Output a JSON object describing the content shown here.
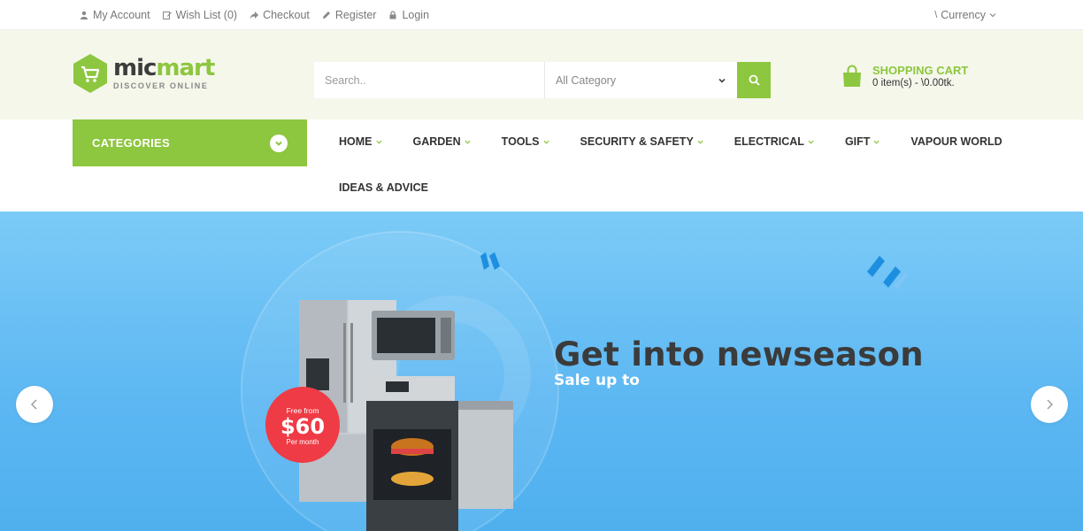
{
  "topbar": {
    "links": [
      {
        "label": "My Account",
        "icon": "user-icon"
      },
      {
        "label": "Wish List (0)",
        "icon": "edit-icon"
      },
      {
        "label": "Checkout",
        "icon": "share-icon"
      },
      {
        "label": "Register",
        "icon": "pencil-icon"
      },
      {
        "label": "Login",
        "icon": "lock-icon"
      }
    ],
    "currency_symbol": "\\",
    "currency_label": "Currency"
  },
  "header": {
    "logo_mic": "mic",
    "logo_mart": "mart",
    "logo_tagline": "DISCOVER ONLINE",
    "search_placeholder": "Search..",
    "category_selected": "All Category",
    "cart_title": "SHOPPING CART",
    "cart_summary": "0 item(s) - \\0.00tk."
  },
  "nav": {
    "categories_label": "CATEGORIES",
    "items": [
      {
        "label": "HOME",
        "has_dropdown": true
      },
      {
        "label": "GARDEN",
        "has_dropdown": true
      },
      {
        "label": "TOOLS",
        "has_dropdown": true
      },
      {
        "label": "SECURITY & SAFETY",
        "has_dropdown": true
      },
      {
        "label": "ELECTRICAL",
        "has_dropdown": true
      },
      {
        "label": "GIFT",
        "has_dropdown": true
      },
      {
        "label": "VAPOUR WORLD",
        "has_dropdown": false
      },
      {
        "label": "IDEAS & ADVICE",
        "has_dropdown": false
      }
    ]
  },
  "hero": {
    "title": "Get into newseason",
    "subtitle": "Sale up to",
    "badge_top": "Free from",
    "badge_price": "$60",
    "badge_bottom": "Per month"
  },
  "colors": {
    "accent": "#8dc63f",
    "header_bg": "#f4f7ea",
    "hero_bg": "#5cb7f2",
    "badge": "#ef3b45"
  }
}
